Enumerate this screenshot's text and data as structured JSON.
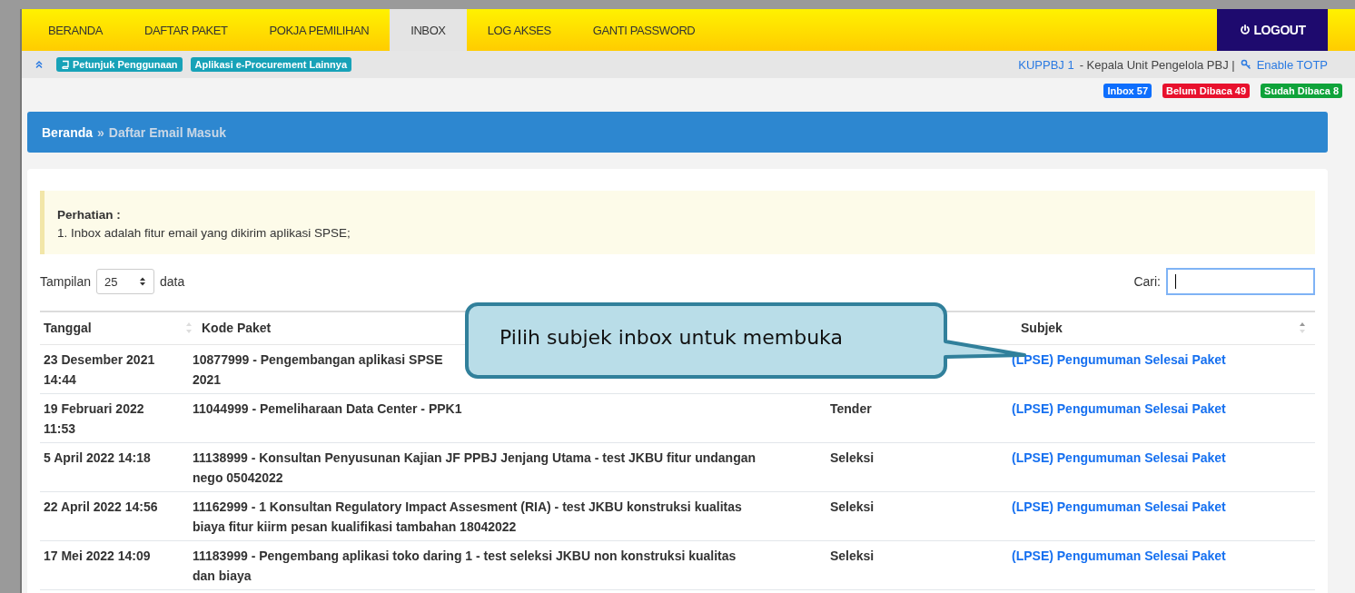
{
  "nav": {
    "items": [
      {
        "label": "BERANDA",
        "selected": false
      },
      {
        "label": "DAFTAR PAKET",
        "selected": false
      },
      {
        "label": "POKJA PEMILIHAN",
        "selected": false
      },
      {
        "label": "INBOX",
        "selected": true
      },
      {
        "label": "LOG AKSES",
        "selected": false
      },
      {
        "label": "GANTI PASSWORD",
        "selected": false
      }
    ],
    "logout": "LOGOUT"
  },
  "subbar": {
    "links": [
      {
        "label": "Petunjuk Penggunaan",
        "kind": "book"
      },
      {
        "label": "Aplikasi e-Procurement Lainnya",
        "kind": "plain"
      }
    ],
    "user": {
      "unit": "KUPPBJ 1",
      "role": "- Kepala Unit Pengelola PBJ |",
      "totp": "Enable TOTP"
    }
  },
  "counters": [
    {
      "label": "Inbox 57",
      "color": "#0d6efd"
    },
    {
      "label": "Belum Dibaca 49",
      "color": "#e8112d"
    },
    {
      "label": "Sudah Dibaca 8",
      "color": "#0fa33a"
    }
  ],
  "breadcrumb": {
    "home": "Beranda",
    "separator": "»",
    "current": "Daftar Email Masuk"
  },
  "notice": {
    "title": "Perhatian :",
    "lines": [
      "1. Inbox adalah fitur email yang dikirim aplikasi SPSE;"
    ]
  },
  "length": {
    "before": "Tampilan",
    "value": "25",
    "after": "data"
  },
  "search": {
    "label": "Cari:",
    "focused": true
  },
  "table": {
    "headers": {
      "tanggal": "Tanggal",
      "kode_paket": "Kode Paket",
      "subjek": "Subjek"
    },
    "rows": [
      {
        "tanggal": "23 Desember 2021\n14:44",
        "kode_paket": "10877999 - Pengembangan aplikasi SPSE\n2021",
        "subjek": "(LPSE) Pengumuman Selesai Paket"
      },
      {
        "tanggal": "19 Februari 2022\n11:53",
        "kode_paket": "11044999 - Pemeliharaan Data Center - PPK1",
        "column_3": "Tender",
        "subjek": "(LPSE) Pengumuman Selesai Paket"
      },
      {
        "tanggal": "5 April 2022 14:18",
        "kode_paket": "11138999 - Konsultan Penyusunan Kajian JF PPBJ Jenjang Utama - test JKBU fitur undangan\nnego 05042022",
        "column_3": "Seleksi",
        "subjek": "(LPSE) Pengumuman Selesai Paket"
      },
      {
        "tanggal": "22 April 2022 14:56",
        "kode_paket": "11162999 - 1 Konsultan Regulatory Impact Assesment (RIA) - test JKBU konstruksi kualitas\nbiaya fitur kiirm pesan kualifikasi tambahan 18042022",
        "column_3": "Seleksi",
        "subjek": "(LPSE) Pengumuman Selesai Paket"
      },
      {
        "tanggal": "17 Mei 2022 14:09",
        "kode_paket": "11183999 - Pengembang aplikasi toko daring 1 - test seleksi JKBU non konstruksi kualitas\ndan biaya",
        "column_3": "Seleksi",
        "subjek": "(LPSE) Pengumuman Selesai Paket"
      }
    ]
  },
  "callout": {
    "text": "Pilih subjek inbox untuk membuka"
  }
}
